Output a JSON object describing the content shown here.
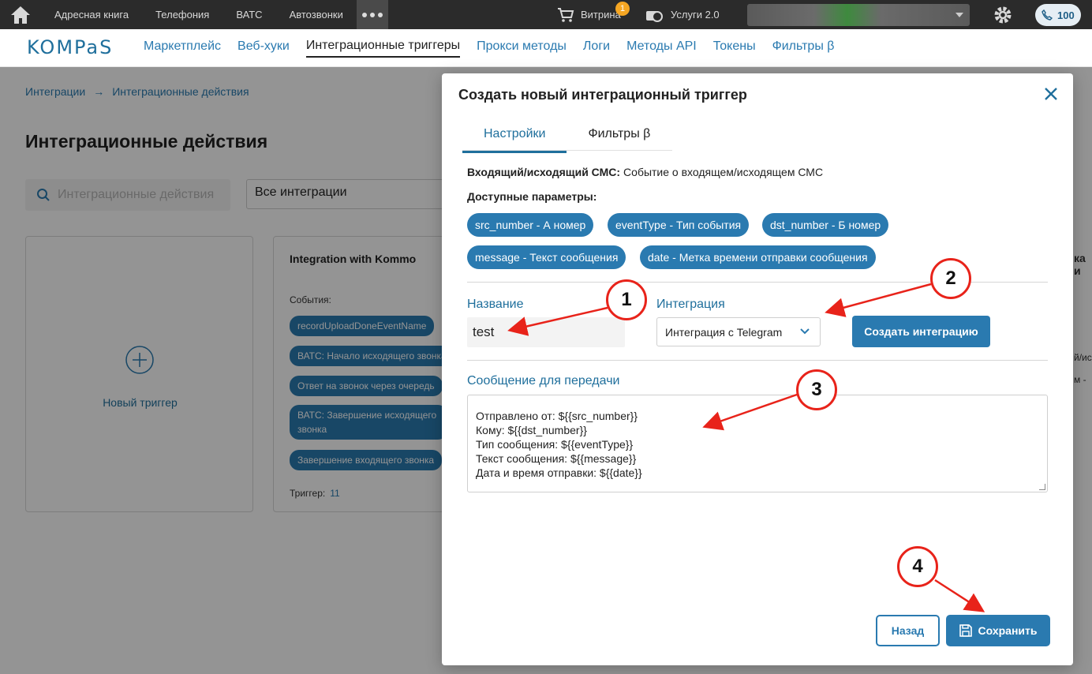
{
  "topbar": {
    "nav": [
      "Адресная книга",
      "Телефония",
      "ВАТС",
      "Автозвонки"
    ],
    "shop_label": "Витрина",
    "shop_badge": "1",
    "services_label": "Услуги 2.0",
    "calls_count": "100"
  },
  "subbar": {
    "logo": "KOMPaS",
    "nav": [
      "Маркетплейс",
      "Веб-хуки",
      "Интеграционные триггеры",
      "Прокси методы",
      "Логи",
      "Методы API",
      "Токены",
      "Фильтры β"
    ],
    "active_index": 2
  },
  "page": {
    "breadcrumb": [
      "Интеграции",
      "Интеграционные действия"
    ],
    "title": "Интеграционные действия",
    "search_placeholder": "Интеграционные действия",
    "filter_value": "Все интеграции",
    "new_trigger_label": "Новый триггер",
    "card": {
      "title": "Integration with Kommo",
      "events_label": "События:",
      "events": [
        "recordUploadDoneEventName",
        "ВАТС: Начало исходящего звонка",
        "Ответ на звонок через очередь",
        "ВАТС: Завершение исходящего звонка",
        "Завершение входящего звонка"
      ],
      "trigger_label": "Триггер:",
      "trigger_value": "11"
    },
    "right_fragments": [
      "ка и",
      "й/ис",
      "м -"
    ]
  },
  "modal": {
    "title": "Создать новый интеграционный триггер",
    "tabs": [
      "Настройки",
      "Фильтры β"
    ],
    "event_type_label": "Входящий/исходящий СМС:",
    "event_type_value": "Событие о входящем/исходящем СМС",
    "params_label": "Доступные параметры:",
    "params": [
      "src_number - А номер",
      "eventType - Тип события",
      "dst_number - Б номер",
      "message - Текст сообщения",
      "date - Метка времени отправки сообщения"
    ],
    "name_label": "Название",
    "name_value": "test",
    "integration_label": "Интеграция",
    "integration_value": "Интеграция с Telegram",
    "create_integration_button": "Создать интеграцию",
    "message_label": "Сообщение для передачи",
    "message_lines": [
      "Отправлено от: ${{src_number}}",
      "Кому: ${{dst_number}}",
      "Тип сообщения: ${{eventType}}",
      "Текст сообщения: ${{message}}",
      "Дата и время отправки: ${{date}}"
    ],
    "back_button": "Назад",
    "save_button": "Сохранить"
  },
  "annotations": [
    "1",
    "2",
    "3",
    "4"
  ],
  "colors": {
    "accent": "#2a7ab0",
    "annotation": "#e8231a",
    "topbar": "#2b2b2b"
  },
  "icons": [
    "home-icon",
    "cart-icon",
    "services-icon",
    "gear-icon",
    "phone-icon",
    "search-icon",
    "chevron-down-icon",
    "plus-circle-icon",
    "close-icon",
    "save-icon",
    "arrow-right-icon"
  ]
}
